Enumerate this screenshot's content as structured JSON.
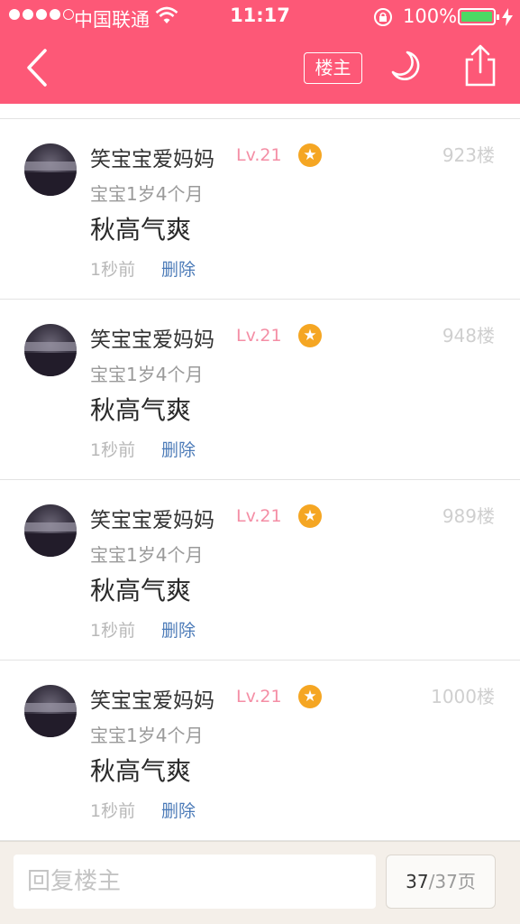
{
  "status_bar": {
    "carrier": "中国联通",
    "time": "11:17",
    "battery": "100%",
    "signal_dots_filled": 4,
    "signal_dots_total": 5
  },
  "header": {
    "owner_filter_label": "楼主",
    "icons": [
      "back-icon",
      "moon-icon",
      "share-icon"
    ],
    "background_color": "#fd5877"
  },
  "posts": [
    {
      "username": "笑宝宝爱妈妈",
      "level": "Lv.21",
      "floor": "923楼",
      "baby_age": "宝宝1岁4个月",
      "content": "秋高气爽",
      "time_ago": "1秒前",
      "delete_label": "删除"
    },
    {
      "username": "笑宝宝爱妈妈",
      "level": "Lv.21",
      "floor": "948楼",
      "baby_age": "宝宝1岁4个月",
      "content": "秋高气爽",
      "time_ago": "1秒前",
      "delete_label": "删除"
    },
    {
      "username": "笑宝宝爱妈妈",
      "level": "Lv.21",
      "floor": "989楼",
      "baby_age": "宝宝1岁4个月",
      "content": "秋高气爽",
      "time_ago": "1秒前",
      "delete_label": "删除"
    },
    {
      "username": "笑宝宝爱妈妈",
      "level": "Lv.21",
      "floor": "1000楼",
      "baby_age": "宝宝1岁4个月",
      "content": "秋高气爽",
      "time_ago": "1秒前",
      "delete_label": "删除"
    }
  ],
  "reply_bar": {
    "placeholder": "回复楼主",
    "page_current": "37",
    "page_total": "/37页"
  },
  "colors": {
    "accent": "#fd5877",
    "level": "#f48ea5",
    "badge": "#f5a623",
    "link": "#4c7bb8"
  }
}
